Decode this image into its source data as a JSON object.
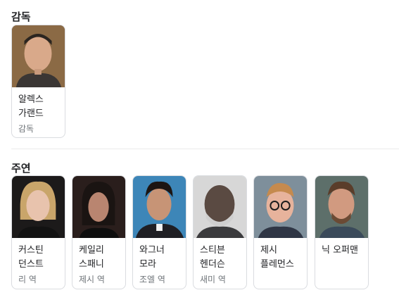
{
  "director_section": {
    "title": "감독",
    "people": [
      {
        "name": "알렉스 가랜드",
        "role": "감독"
      }
    ]
  },
  "cast_section": {
    "title": "주연",
    "people": [
      {
        "name": "커스틴 던스트",
        "role": "리 역"
      },
      {
        "name": "케일리 스패니",
        "role": "제시 역"
      },
      {
        "name": "와그너 모라",
        "role": "조엘 역"
      },
      {
        "name": "스티븐 헨더슨",
        "role": "새미 역"
      },
      {
        "name": "제시 플레먼스",
        "role": ""
      },
      {
        "name": "닉 오퍼맨",
        "role": ""
      }
    ]
  }
}
